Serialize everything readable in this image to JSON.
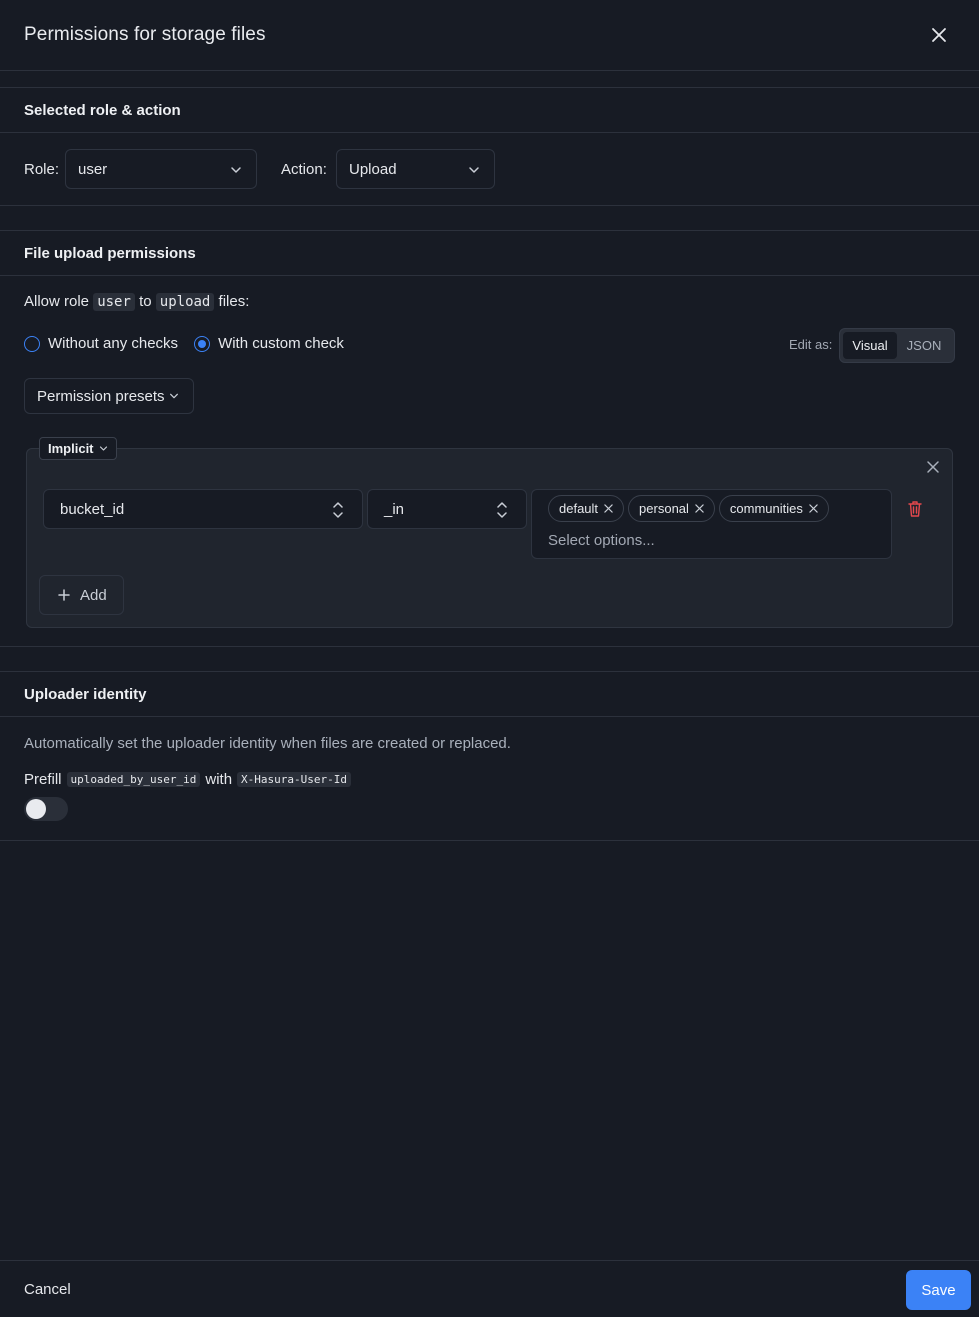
{
  "header": {
    "title": "Permissions for storage files"
  },
  "role_action": {
    "section_title": "Selected role & action",
    "role_label": "Role:",
    "role_value": "user",
    "action_label": "Action:",
    "action_value": "Upload"
  },
  "upload_permissions": {
    "section_title": "File upload permissions",
    "allow_prefix": "Allow role",
    "allow_role": "user",
    "allow_to": "to",
    "allow_action": "upload",
    "allow_suffix": "files:",
    "radio_without": "Without any checks",
    "radio_custom": "With custom check",
    "selected_radio": "With custom check",
    "edit_as_label": "Edit as:",
    "edit_modes": [
      "Visual",
      "JSON"
    ],
    "active_mode": "Visual",
    "presets_label": "Permission presets",
    "group_operator": "Implicit",
    "rule": {
      "column": "bucket_id",
      "operator": "_in",
      "values": [
        "default",
        "personal",
        "communities"
      ],
      "placeholder": "Select options..."
    },
    "add_label": "Add"
  },
  "uploader": {
    "section_title": "Uploader identity",
    "description": "Automatically set the uploader identity when files are created or replaced.",
    "prefill_label": "Prefill",
    "prefill_column": "uploaded_by_user_id",
    "prefill_with": "with",
    "prefill_source": "X-Hasura-User-Id",
    "toggle_on": false
  },
  "footer": {
    "cancel_label": "Cancel",
    "save_label": "Save"
  },
  "colors": {
    "accent": "#3b82f6",
    "danger": "#e5484d",
    "background": "#171b24"
  },
  "icons": [
    "close-icon",
    "chevron-down-icon",
    "updown-icon",
    "trash-icon",
    "plus-icon"
  ]
}
